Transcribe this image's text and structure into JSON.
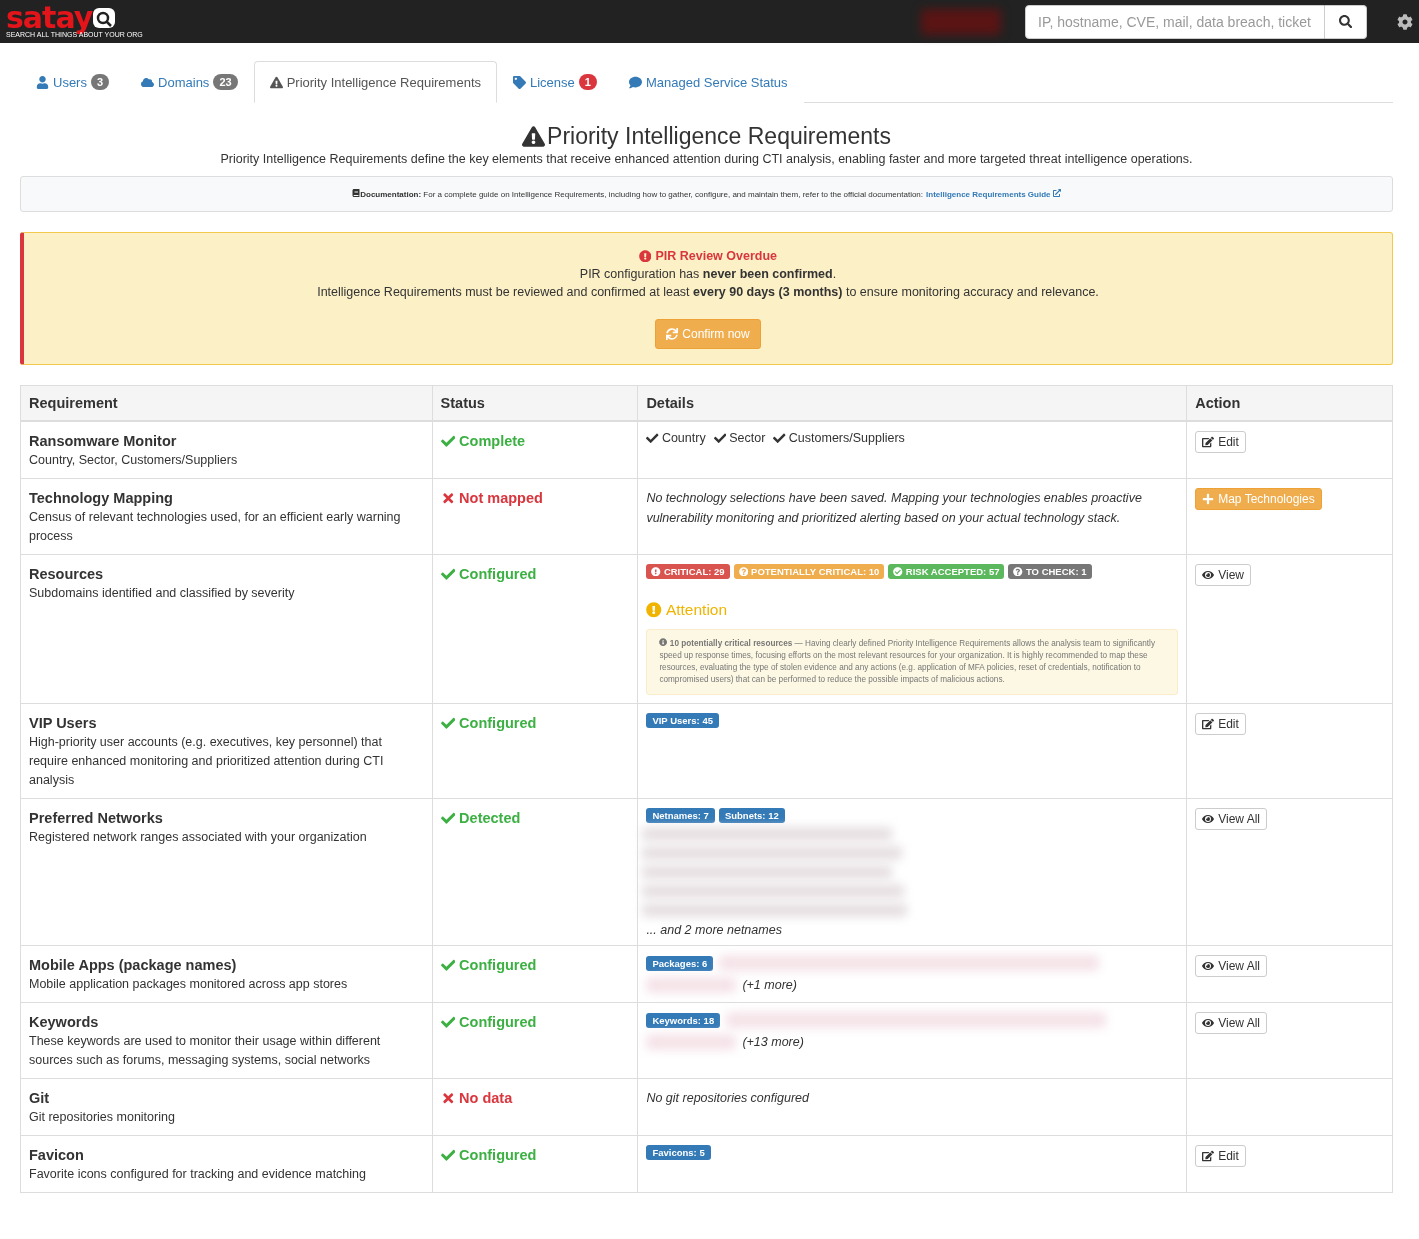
{
  "navbar": {
    "logo": {
      "wordmark": "satay",
      "tagline": "SEARCH ALL THINGS ABOUT YOUR ORG"
    },
    "search": {
      "placeholder": "IP, hostname, CVE, mail, data breach, ticket"
    }
  },
  "tabs": [
    {
      "kind": "user",
      "label": "Users",
      "count": "3",
      "color": "#777777",
      "selected": false
    },
    {
      "kind": "cloud",
      "label": "Domains",
      "count": "23",
      "color": "#777777",
      "selected": false
    },
    {
      "kind": "warning",
      "label": "Priority Intelligence Requirements",
      "selected": true
    },
    {
      "kind": "tag",
      "label": "License",
      "count": "1",
      "color": "#d9363e",
      "selected": false
    },
    {
      "kind": "comment",
      "label": "Managed Service Status",
      "selected": false
    }
  ],
  "header": {
    "title": "Priority Intelligence Requirements",
    "subtitle": "Priority Intelligence Requirements define the key elements that receive enhanced attention during CTI analysis, enabling faster and more targeted threat intelligence operations."
  },
  "documentation": {
    "text": "**Documentation:** For a complete guide on Intelligence Requirements, including how to gather, configure, and maintain them, refer to the official documentation:",
    "link": "Intelligence Requirements Guide"
  },
  "alert": {
    "title": "PIR Review Overdue",
    "lines": [
      "PIR configuration has **never been confirmed**.",
      "Intelligence Requirements must be reviewed and confirmed at least **every 90 days (3 months)** to ensure monitoring accuracy and relevance."
    ],
    "button": "Confirm now"
  },
  "table": {
    "columns": [
      "Requirement",
      "Status",
      "Details",
      "Action"
    ],
    "rows": [
      {
        "name": "Ransomware Monitor",
        "description": "Country, Sector, Customers/Suppliers",
        "status": {
          "kind": "ok",
          "label": "Complete"
        },
        "details": {
          "kind": "checks",
          "items": [
            "Country",
            "Sector",
            "Customers/Suppliers"
          ]
        },
        "action": {
          "kind": "edit",
          "label": "Edit"
        }
      },
      {
        "name": "Technology Mapping",
        "description": "Census of relevant technologies used, for an efficient early warning process",
        "status": {
          "kind": "error",
          "label": "Not mapped"
        },
        "details": {
          "kind": "note",
          "text": "No technology selections have been saved. Mapping your technologies enables proactive vulnerability monitoring and prioritized alerting based on your actual technology stack."
        },
        "action": {
          "kind": "add",
          "label": "Map Technologies"
        }
      },
      {
        "name": "Resources",
        "description": "Subdomains identified and classified by severity",
        "status": {
          "kind": "ok",
          "label": "Configured"
        },
        "details": {
          "kind": "severity",
          "badges": [
            {
              "kind": "critical",
              "label": "CRITICAL: 29",
              "color": "#d9534f"
            },
            {
              "kind": "potential",
              "label": "POTENTIALLY CRITICAL: 10",
              "color": "#f0ad4e"
            },
            {
              "kind": "accepted",
              "label": "RISK ACCEPTED: 57",
              "color": "#5cb85c"
            },
            {
              "kind": "check",
              "label": "TO CHECK: 1",
              "color": "#777777"
            }
          ],
          "attention": {
            "title": "Attention",
            "text": "**10 potentially critical resources** — Having clearly defined Priority Intelligence Requirements allows the analysis team to significantly speed up response times, focusing efforts on the most relevant resources for your organization. It is highly recommended to map these resources, evaluating the type of stolen evidence and any actions (e.g. application of MFA policies, reset of credentials, notification to compromised users) that can be performed to reduce the possible impacts of malicious actions."
          }
        },
        "action": {
          "kind": "view",
          "label": "View"
        }
      },
      {
        "name": "VIP Users",
        "description": "High-priority user accounts (e.g. executives, key personnel) that require enhanced monitoring and prioritized attention during CTI analysis",
        "status": {
          "kind": "ok",
          "label": "Configured"
        },
        "details": {
          "kind": "tags",
          "tags": [
            "VIP Users: 45"
          ]
        },
        "action": {
          "kind": "edit",
          "label": "Edit"
        }
      },
      {
        "name": "Preferred Networks",
        "description": "Registered network ranges associated with your organization",
        "status": {
          "kind": "ok",
          "label": "Detected"
        },
        "details": {
          "kind": "list",
          "tags": [
            "Netnames: 7",
            "Subnets: 12"
          ],
          "more": "... and 2 more netnames"
        },
        "action": {
          "kind": "view",
          "label": "View All"
        }
      },
      {
        "name": "Mobile Apps (package names)",
        "description": "Mobile application packages monitored across app stores",
        "status": {
          "kind": "ok",
          "label": "Configured"
        },
        "details": {
          "kind": "inline",
          "tags": [
            "Packages: 6"
          ],
          "more": "(+1 more)"
        },
        "action": {
          "kind": "view",
          "label": "View All"
        }
      },
      {
        "name": "Keywords",
        "description": "These keywords are used to monitor their usage within different sources such as forums, messaging systems, social networks",
        "status": {
          "kind": "ok",
          "label": "Configured"
        },
        "details": {
          "kind": "inline",
          "tags": [
            "Keywords: 18"
          ],
          "more": "(+13 more)"
        },
        "action": {
          "kind": "view",
          "label": "View All"
        }
      },
      {
        "name": "Git",
        "description": "Git repositories monitoring",
        "status": {
          "kind": "error",
          "label": "No data"
        },
        "details": {
          "kind": "note",
          "text": "No git repositories configured"
        }
      },
      {
        "name": "Favicon",
        "description": "Favorite icons configured for tracking and evidence matching",
        "status": {
          "kind": "ok",
          "label": "Configured"
        },
        "details": {
          "kind": "tags",
          "tags": [
            "Favicons: 5"
          ]
        },
        "action": {
          "kind": "edit",
          "label": "Edit"
        }
      }
    ]
  }
}
